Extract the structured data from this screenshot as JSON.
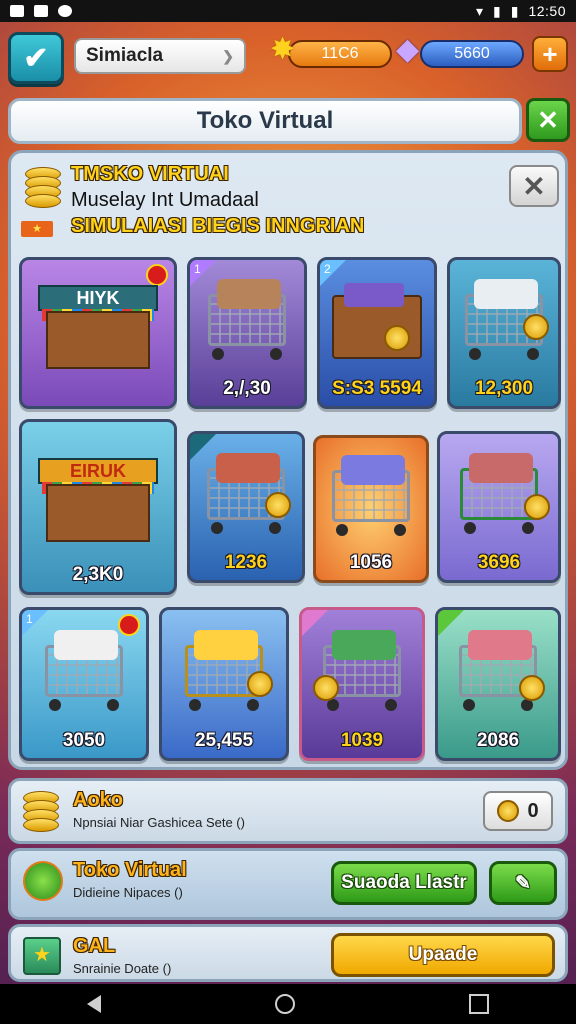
{
  "status_bar": {
    "time": "12:50"
  },
  "top_bar": {
    "player_name": "Simiacla",
    "coins": "11C6",
    "gems": "5660",
    "plus_label": "+"
  },
  "title_bar": {
    "title": "Toko Virtual",
    "close_label": "✕"
  },
  "panel": {
    "header_line1": "TMSKO VIRTUAI",
    "header_line2": "Muselay Int Umadaal",
    "header_line3": "SIMULAIASI BIEGIS INNGRIAN",
    "flag_text": "★",
    "close_label": "✕"
  },
  "items": [
    {
      "type": "shop",
      "sign": "HIYK",
      "price": "",
      "badge": true,
      "corner": ""
    },
    {
      "type": "cart",
      "price": "2,/,30",
      "corner": "1"
    },
    {
      "type": "cart",
      "price": "S:S3 5594",
      "corner": "2"
    },
    {
      "type": "cart",
      "price": "12,300",
      "corner": ""
    },
    {
      "type": "shop",
      "sign": "EIRUK",
      "price": "2,3K0",
      "corner": ""
    },
    {
      "type": "cart",
      "price": "1236",
      "corner": ""
    },
    {
      "type": "cart",
      "price": "1056",
      "corner": ""
    },
    {
      "type": "cart",
      "price": "3696",
      "corner": ""
    },
    {
      "type": "cart",
      "price": "3050",
      "corner": "1",
      "badge": true
    },
    {
      "type": "cart",
      "price": "25,455",
      "corner": ""
    },
    {
      "type": "cart",
      "price": "1039",
      "corner": ""
    },
    {
      "type": "cart",
      "price": "2086",
      "corner": ""
    }
  ],
  "rows": {
    "aoko": {
      "title": "Aoko",
      "subtitle": "Npnsiai Niar Gashicea Sete ()",
      "count": "0"
    },
    "toko": {
      "title": "Toko Virtual",
      "subtitle": "Didieine Nipaces ()",
      "button_label": "Suaoda Llastr"
    },
    "gal": {
      "title": "GAL",
      "subtitle": "Snrainie Doate ()",
      "button_label": "Upaade"
    }
  },
  "colors": {
    "accent_gold": "#ffd31a",
    "button_green": "#2e9a18",
    "button_yellow": "#f0a800"
  }
}
